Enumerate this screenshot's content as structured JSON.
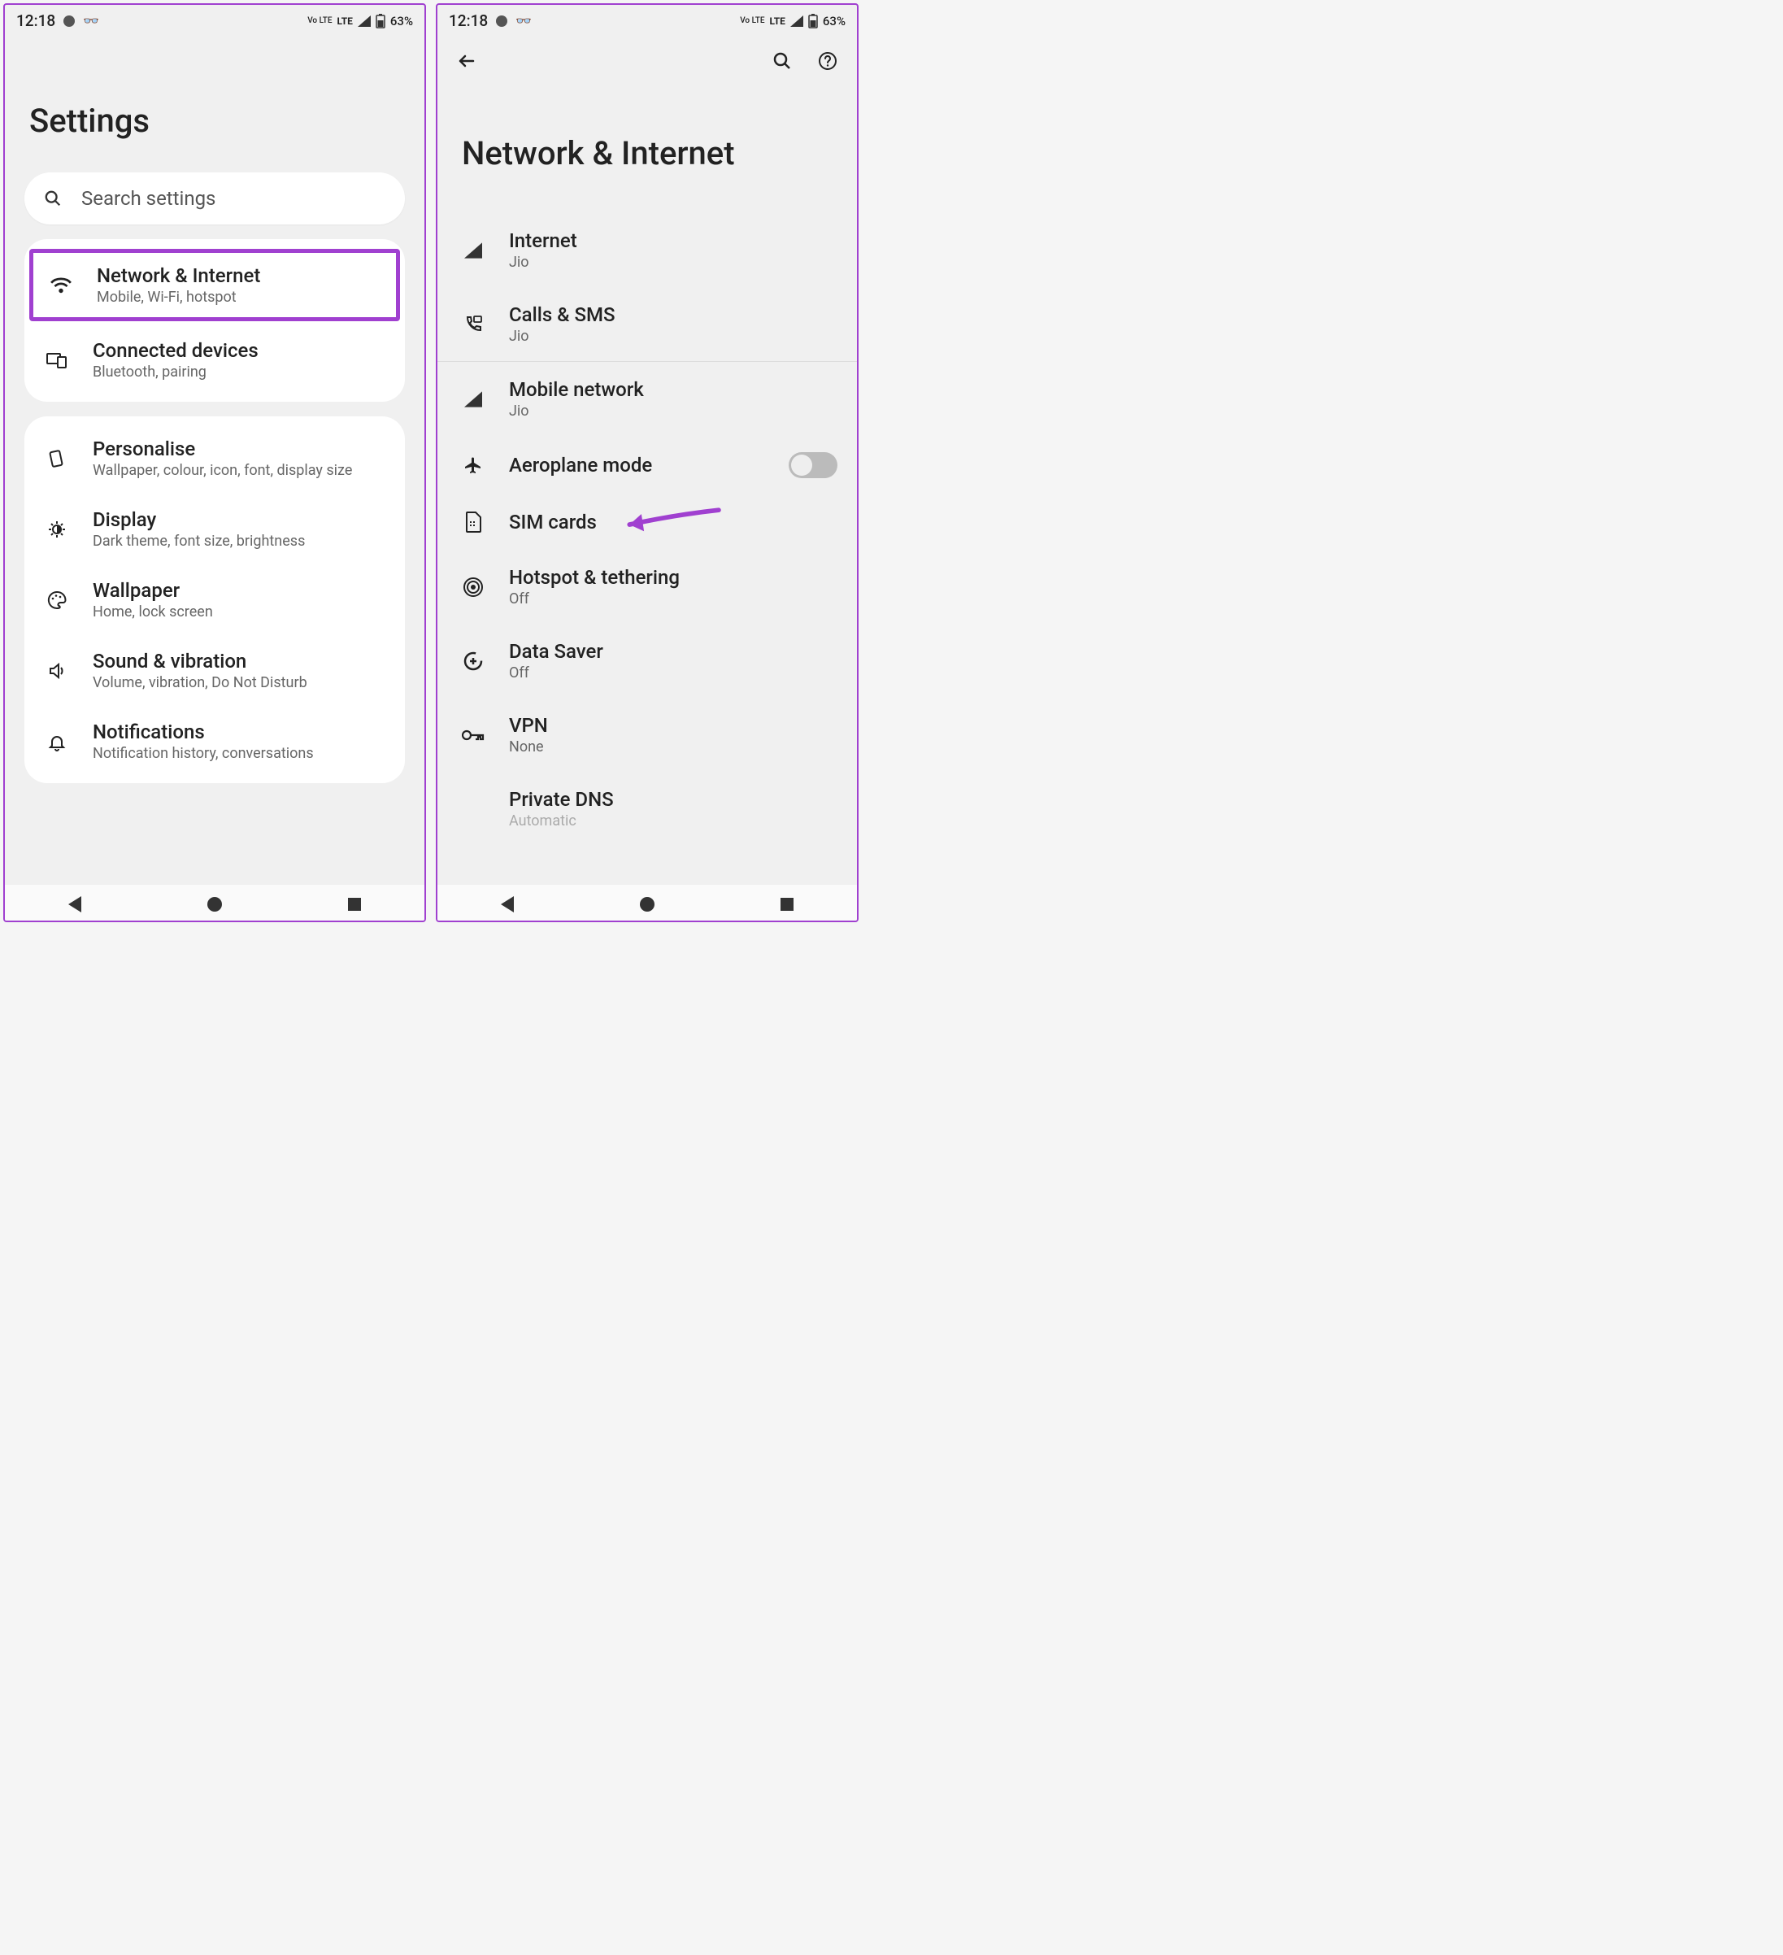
{
  "statusbar": {
    "time": "12:18",
    "net1": "Vo LTE",
    "net2": "LTE",
    "battery": "63%"
  },
  "left": {
    "title": "Settings",
    "search_placeholder": "Search settings",
    "group1": [
      {
        "title": "Network & Internet",
        "sub": "Mobile, Wi-Fi, hotspot",
        "highlight": true
      },
      {
        "title": "Connected devices",
        "sub": "Bluetooth, pairing"
      }
    ],
    "group2": [
      {
        "title": "Personalise",
        "sub": "Wallpaper, colour, icon, font, display size"
      },
      {
        "title": "Display",
        "sub": "Dark theme, font size, brightness"
      },
      {
        "title": "Wallpaper",
        "sub": "Home, lock screen"
      },
      {
        "title": "Sound & vibration",
        "sub": "Volume, vibration, Do Not Disturb"
      },
      {
        "title": "Notifications",
        "sub": "Notification history, conversations"
      }
    ]
  },
  "right": {
    "title": "Network & Internet",
    "items": [
      {
        "title": "Internet",
        "sub": "Jio"
      },
      {
        "title": "Calls & SMS",
        "sub": "Jio"
      },
      {
        "title": "Mobile network",
        "sub": "Jio"
      },
      {
        "title": "Aeroplane mode",
        "toggle": true
      },
      {
        "title": "SIM cards",
        "arrow": true
      },
      {
        "title": "Hotspot & tethering",
        "sub": "Off"
      },
      {
        "title": "Data Saver",
        "sub": "Off"
      },
      {
        "title": "VPN",
        "sub": "None"
      },
      {
        "title": "Private DNS",
        "sub": "Automatic"
      }
    ]
  }
}
